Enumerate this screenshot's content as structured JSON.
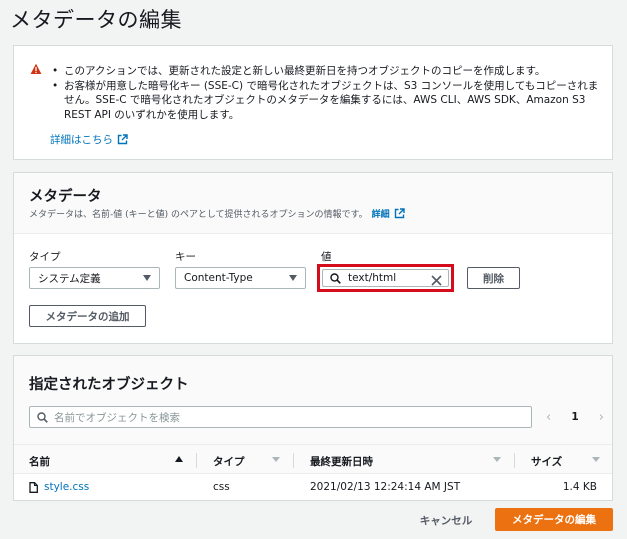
{
  "page": {
    "title": "メタデータの編集"
  },
  "warning": {
    "bullets": [
      "このアクションでは、更新された設定と新しい最終更新日を持つオブジェクトのコピーを作成します。",
      "お客様が用意した暗号化キー (SSE-C) で暗号化されたオブジェクトは、S3 コンソールを使用してもコピーされません。SSE-C で暗号化されたオブジェクトのメタデータを編集するには、AWS CLI、AWS SDK、Amazon S3 REST API のいずれかを使用します。"
    ],
    "link": "詳細はこちら",
    "icon": "warning-triangle-icon",
    "icon_color": "#d13212"
  },
  "metadata": {
    "title": "メタデータ",
    "description": "メタデータは、名前-値 (キーと値) のペアとして提供されるオプションの情報です。",
    "description_link": "詳細",
    "labels": {
      "type": "タイプ",
      "key": "キー",
      "value": "値"
    },
    "type_value": "システム定義",
    "key_value": "Content-Type",
    "value_value": "text/html",
    "remove_button": "削除",
    "add_button": "メタデータの追加"
  },
  "objects": {
    "title": "指定されたオブジェクト",
    "search_placeholder": "名前でオブジェクトを検索",
    "page": "1",
    "columns": [
      "名前",
      "タイプ",
      "最終更新日時",
      "サイズ"
    ],
    "rows": [
      {
        "name": "style.css",
        "type": "css",
        "modified": "2021/02/13 12:24:14 AM JST",
        "size": "1.4 KB"
      }
    ]
  },
  "footer": {
    "cancel": "キャンセル",
    "submit": "メタデータの編集"
  },
  "colors": {
    "accent": "#ec7211",
    "link": "#0073bb",
    "highlight_border": "#d40c1c"
  }
}
